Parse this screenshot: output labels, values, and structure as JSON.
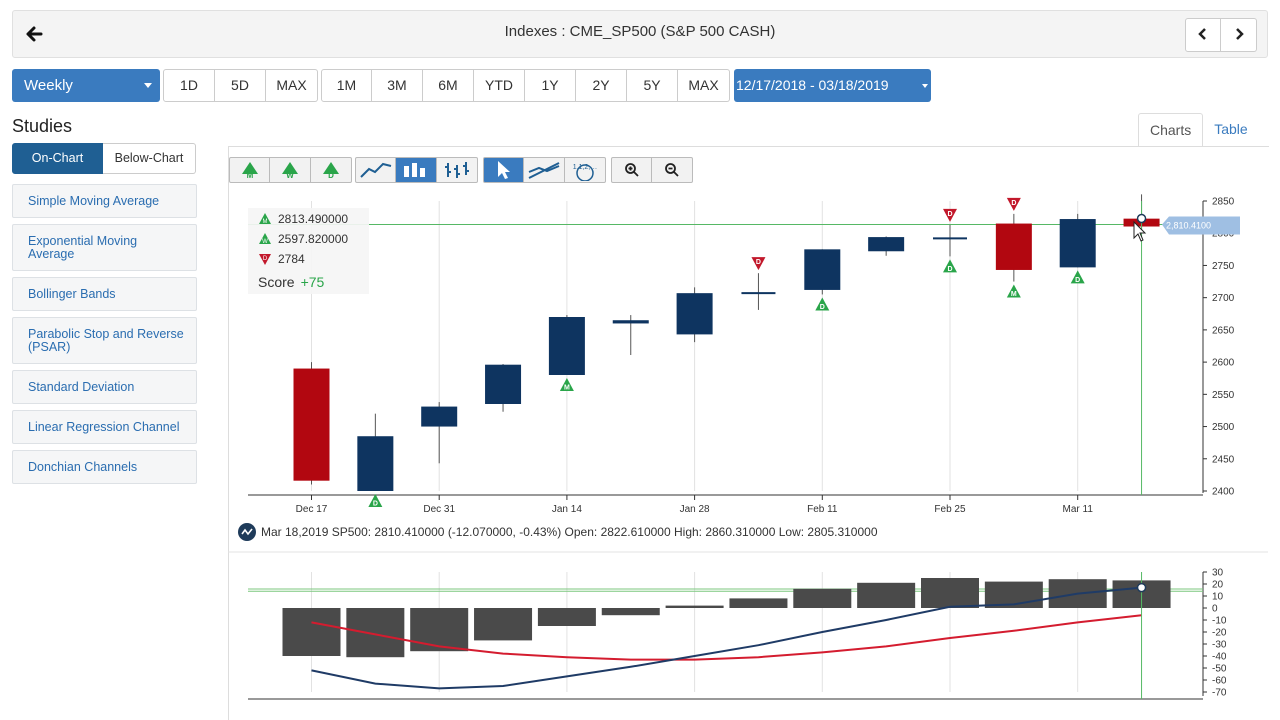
{
  "header": {
    "title": "Indexes : CME_SP500 (S&P 500 CASH)",
    "back_icon": "arrow-left-icon",
    "prev_icon": "chevron-left-icon",
    "next_icon": "chevron-right-icon"
  },
  "range": {
    "period": "Weekly",
    "quick_a": [
      "1D",
      "5D",
      "MAX"
    ],
    "quick_b": [
      "1M",
      "3M",
      "6M",
      "YTD",
      "1Y",
      "2Y",
      "5Y",
      "MAX"
    ],
    "date_range": "12/17/2018 - 03/18/2019"
  },
  "studies": {
    "title": "Studies",
    "tabs": [
      "On-Chart",
      "Below-Chart"
    ],
    "items": [
      "Simple Moving Average",
      "Exponential Moving Average",
      "Bollinger Bands",
      "Parabolic Stop and Reverse (PSAR)",
      "Standard Deviation",
      "Linear Regression Channel",
      "Donchian Channels"
    ]
  },
  "view_tabs": [
    "Charts",
    "Table"
  ],
  "toolbar": {
    "icons": [
      "monthly-signal-icon",
      "weekly-signal-icon",
      "daily-signal-icon",
      "line-chart-icon",
      "bar-chart-icon",
      "ohlc-chart-icon",
      "cursor-icon",
      "trendline-icon",
      "fibonacci-icon",
      "zoom-in-icon",
      "zoom-out-icon"
    ]
  },
  "signals": {
    "rows": [
      {
        "type": "up",
        "value": "2813.490000"
      },
      {
        "type": "up",
        "value": "2597.820000"
      },
      {
        "type": "down",
        "value": "2784"
      }
    ],
    "score_label": "Score",
    "score_value": "+75"
  },
  "readout": "Mar 18,2019 SP500: 2810.410000 (-12.070000, -0.43%) Open: 2822.610000 High: 2860.310000 Low: 2805.310000",
  "colors": {
    "up": "#0e3460",
    "down": "#b20710",
    "signal_up": "#2aa54a",
    "signal_down": "#c2182b",
    "accent": "#3a7bbf"
  },
  "chart_data": [
    {
      "type": "candlestick",
      "x_tick_labels": [
        "Dec 17",
        "Dec 31",
        "Jan 14",
        "Jan 28",
        "Feb 11",
        "Feb 25",
        "Mar 11"
      ],
      "y_ticks": [
        2400,
        2450,
        2500,
        2550,
        2600,
        2650,
        2700,
        2750,
        2800,
        2850
      ],
      "ylim": [
        2400,
        2850
      ],
      "price_tag": "2,810.4100",
      "reference_line": 2813.49,
      "candles": [
        {
          "open": 2590,
          "high": 2600,
          "low": 2410,
          "close": 2416,
          "signal": ""
        },
        {
          "open": 2400,
          "high": 2520,
          "low": 2400,
          "close": 2485,
          "signal": "D"
        },
        {
          "open": 2500,
          "high": 2538,
          "low": 2443,
          "close": 2531,
          "signal": ""
        },
        {
          "open": 2535,
          "high": 2597,
          "low": 2523,
          "close": 2596,
          "signal": ""
        },
        {
          "open": 2580,
          "high": 2673,
          "low": 2580,
          "close": 2670,
          "signal": "M"
        },
        {
          "open": 2660,
          "high": 2673,
          "low": 2611,
          "close": 2665,
          "signal": ""
        },
        {
          "open": 2643,
          "high": 2716,
          "low": 2631,
          "close": 2707,
          "signal": ""
        },
        {
          "open": 2705,
          "high": 2738,
          "low": 2681,
          "close": 2707,
          "signal": "D-down"
        },
        {
          "open": 2712,
          "high": 2775,
          "low": 2705,
          "close": 2775,
          "signal": "D"
        },
        {
          "open": 2772,
          "high": 2795,
          "low": 2765,
          "close": 2794,
          "signal": ""
        },
        {
          "open": 2791,
          "high": 2813,
          "low": 2764,
          "close": 2792,
          "signal": "D|D-down"
        },
        {
          "open": 2815,
          "high": 2830,
          "low": 2725,
          "close": 2743,
          "signal": "M|D-down"
        },
        {
          "open": 2747,
          "high": 2830,
          "low": 2747,
          "close": 2822,
          "signal": "D"
        },
        {
          "open": 2822.61,
          "high": 2860.31,
          "low": 2805.31,
          "close": 2810.41,
          "signal": ""
        }
      ]
    },
    {
      "type": "histogram+lines",
      "y_ticks": [
        30,
        20,
        10,
        0,
        -10,
        -20,
        -30,
        -40,
        -50,
        -60,
        -70
      ],
      "ylim": [
        -70,
        30
      ],
      "histogram": [
        -40,
        -41,
        -36,
        -27,
        -15,
        -6,
        2,
        8,
        16,
        21,
        25,
        22,
        24,
        23
      ],
      "line_blue": [
        -52,
        -63,
        -67,
        -65,
        -57,
        -49,
        -40,
        -31,
        -20,
        -10,
        1,
        3,
        12,
        17
      ],
      "line_red": [
        -12,
        -22,
        -32,
        -38,
        -41,
        -43,
        -43,
        -41,
        -37,
        -32,
        -25,
        -19,
        -12,
        -6
      ]
    }
  ]
}
